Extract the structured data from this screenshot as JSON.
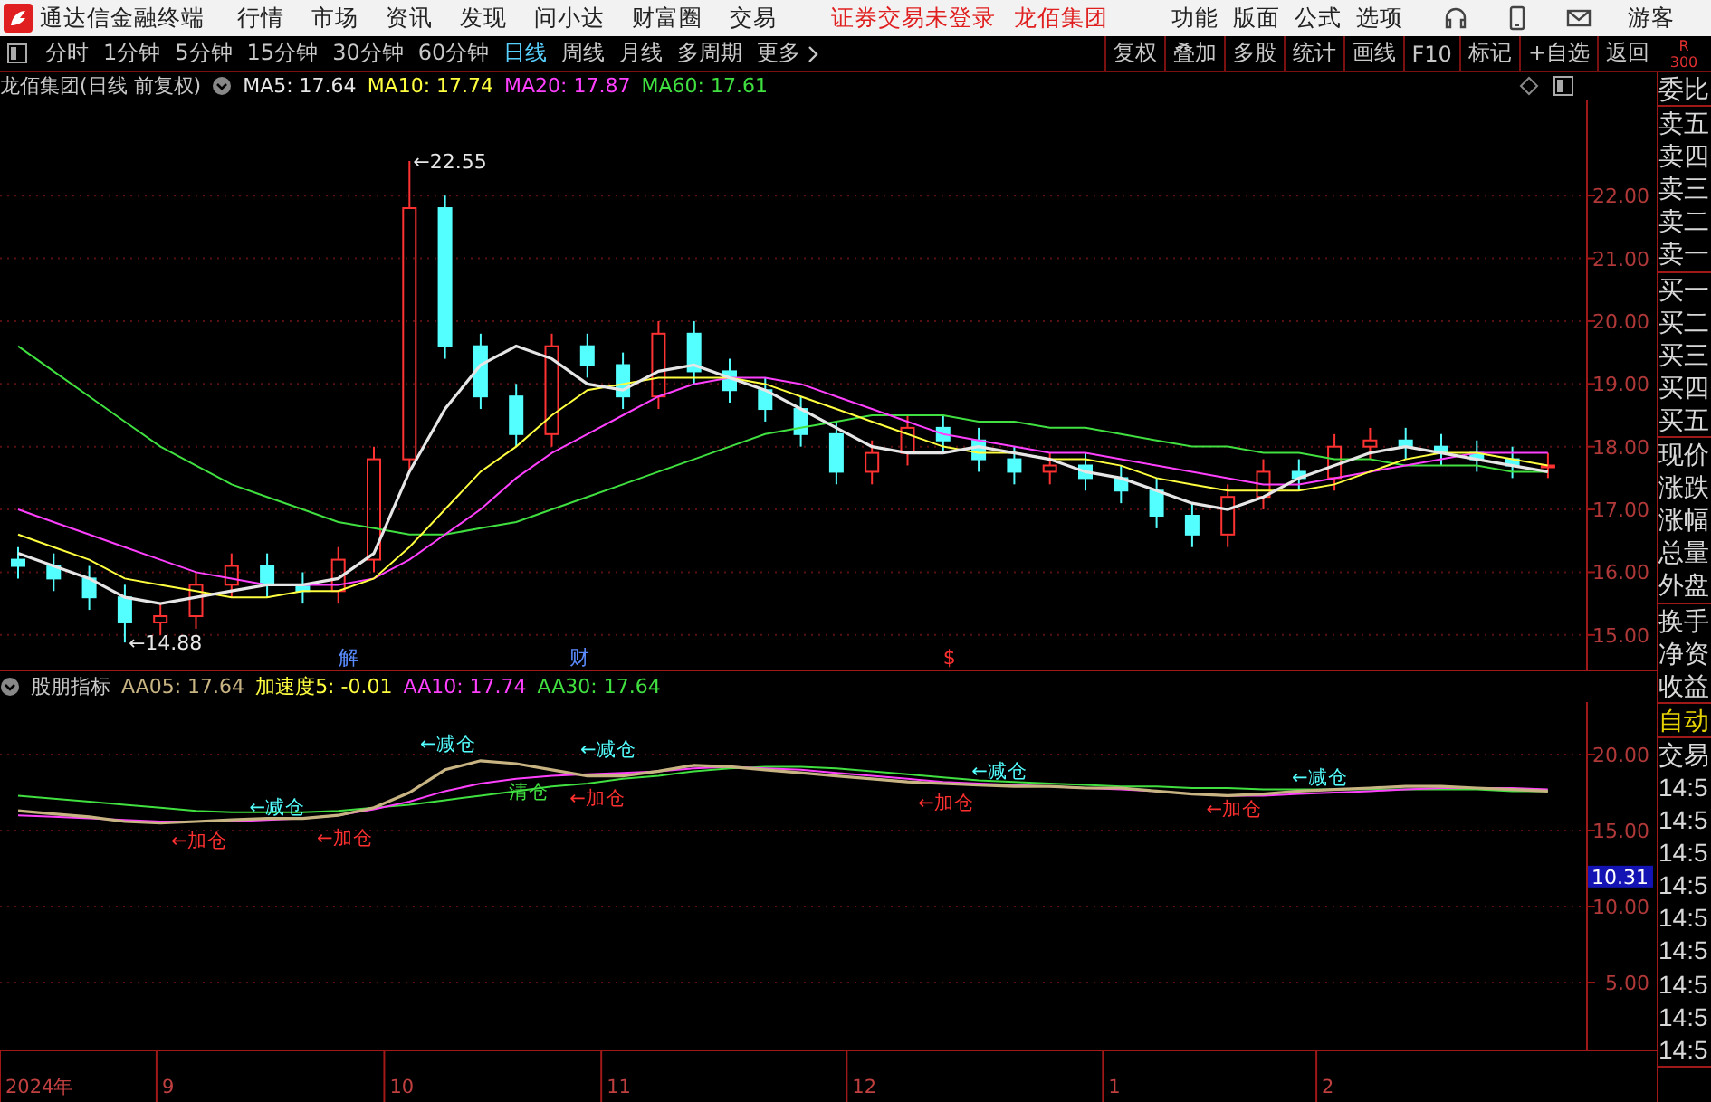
{
  "header": {
    "app_title": "通达信金融终端",
    "menu": [
      "行情",
      "市场",
      "资讯",
      "发现",
      "问小达",
      "财富圈",
      "交易"
    ],
    "notices": [
      "证券交易未登录",
      "龙佰集团"
    ],
    "right_menu": [
      "功能",
      "版面",
      "公式",
      "选项"
    ],
    "user": "游客"
  },
  "toolbar": {
    "periods": [
      {
        "label": "分时",
        "selected": false
      },
      {
        "label": "1分钟",
        "selected": false
      },
      {
        "label": "5分钟",
        "selected": false
      },
      {
        "label": "15分钟",
        "selected": false
      },
      {
        "label": "30分钟",
        "selected": false
      },
      {
        "label": "60分钟",
        "selected": false
      },
      {
        "label": "日线",
        "selected": true
      },
      {
        "label": "周线",
        "selected": false
      },
      {
        "label": "月线",
        "selected": false
      },
      {
        "label": "多周期",
        "selected": false
      },
      {
        "label": "更多",
        "selected": false
      }
    ],
    "buttons": [
      "复权",
      "叠加",
      "多股",
      "统计",
      "画线",
      "F10",
      "标记",
      "+自选",
      "返回"
    ],
    "corner": [
      "R",
      "300"
    ]
  },
  "main_panel": {
    "title": "龙佰集团(日线 前复权)",
    "legend_values": [
      ": 17.64",
      ": 17.74",
      ": 17.87",
      ": 17.61"
    ],
    "events": [
      {
        "text": "解",
        "color": "#5a8cff"
      },
      {
        "text": "财",
        "color": "#5a8cff"
      },
      {
        "text": "$",
        "color": "#ff3030"
      }
    ],
    "chart_data": {
      "type": "candlestick",
      "grid": true,
      "ylim": [
        14.45,
        23.53
      ],
      "yticks": [
        {
          "value": 15,
          "label": "15.00"
        },
        {
          "value": 16,
          "label": "16.00"
        },
        {
          "value": 17,
          "label": "17.00"
        },
        {
          "value": 18,
          "label": "18.00"
        },
        {
          "value": 19,
          "label": "19.00"
        },
        {
          "value": 20,
          "label": "20.00"
        },
        {
          "value": 21,
          "label": "21.00"
        },
        {
          "value": 22,
          "label": "22.00"
        }
      ],
      "ohlc": [
        [
          16.2,
          16.4,
          15.9,
          16.1
        ],
        [
          16.1,
          16.3,
          15.7,
          15.9
        ],
        [
          15.9,
          16.1,
          15.4,
          15.6
        ],
        [
          15.6,
          15.8,
          14.88,
          15.2
        ],
        [
          15.2,
          15.5,
          15.0,
          15.3
        ],
        [
          15.3,
          16.0,
          15.1,
          15.8
        ],
        [
          15.8,
          16.3,
          15.6,
          16.1
        ],
        [
          16.1,
          16.3,
          15.6,
          15.8
        ],
        [
          15.8,
          16.0,
          15.5,
          15.7
        ],
        [
          15.7,
          16.4,
          15.5,
          16.2
        ],
        [
          16.2,
          18.0,
          16.0,
          17.8
        ],
        [
          17.8,
          22.55,
          17.6,
          21.8
        ],
        [
          21.8,
          22.0,
          19.4,
          19.6
        ],
        [
          19.6,
          19.8,
          18.6,
          18.8
        ],
        [
          18.8,
          19.0,
          18.0,
          18.2
        ],
        [
          18.2,
          19.8,
          18.0,
          19.6
        ],
        [
          19.6,
          19.8,
          19.1,
          19.3
        ],
        [
          19.3,
          19.5,
          18.6,
          18.8
        ],
        [
          18.8,
          20.0,
          18.6,
          19.8
        ],
        [
          19.8,
          20.0,
          19.0,
          19.2
        ],
        [
          19.2,
          19.4,
          18.7,
          18.9
        ],
        [
          18.9,
          19.1,
          18.4,
          18.6
        ],
        [
          18.6,
          18.8,
          18.0,
          18.2
        ],
        [
          18.2,
          18.4,
          17.4,
          17.6
        ],
        [
          17.6,
          18.1,
          17.4,
          17.9
        ],
        [
          17.9,
          18.5,
          17.7,
          18.3
        ],
        [
          18.3,
          18.5,
          17.9,
          18.1
        ],
        [
          18.1,
          18.3,
          17.6,
          17.8
        ],
        [
          17.8,
          18.0,
          17.4,
          17.6
        ],
        [
          17.6,
          17.9,
          17.4,
          17.7
        ],
        [
          17.7,
          17.9,
          17.3,
          17.5
        ],
        [
          17.5,
          17.7,
          17.1,
          17.3
        ],
        [
          17.3,
          17.5,
          16.7,
          16.9
        ],
        [
          16.9,
          17.1,
          16.4,
          16.6
        ],
        [
          16.6,
          17.4,
          16.4,
          17.2
        ],
        [
          17.2,
          17.8,
          17.0,
          17.6
        ],
        [
          17.6,
          17.8,
          17.3,
          17.5
        ],
        [
          17.5,
          18.2,
          17.3,
          18.0
        ],
        [
          18.0,
          18.3,
          17.8,
          18.1
        ],
        [
          18.1,
          18.3,
          17.8,
          18.0
        ],
        [
          18.0,
          18.2,
          17.7,
          17.9
        ],
        [
          17.9,
          18.1,
          17.6,
          17.8
        ],
        [
          17.8,
          18.0,
          17.5,
          17.7
        ],
        [
          17.7,
          17.9,
          17.5,
          17.7
        ]
      ],
      "series": [
        {
          "name": "MA5",
          "type": "line",
          "color": "#e6e6e6",
          "values": [
            16.3,
            16.1,
            15.9,
            15.6,
            15.5,
            15.6,
            15.7,
            15.8,
            15.8,
            15.9,
            16.3,
            17.6,
            18.6,
            19.3,
            19.6,
            19.4,
            19.0,
            18.9,
            19.2,
            19.3,
            19.1,
            18.9,
            18.6,
            18.3,
            18.0,
            17.9,
            17.9,
            18.0,
            17.9,
            17.8,
            17.6,
            17.5,
            17.3,
            17.1,
            17.0,
            17.2,
            17.5,
            17.7,
            17.9,
            18.0,
            17.9,
            17.8,
            17.7,
            17.6
          ]
        },
        {
          "name": "MA10",
          "type": "line",
          "color": "#ffff40",
          "values": [
            16.6,
            16.4,
            16.2,
            15.9,
            15.8,
            15.7,
            15.6,
            15.6,
            15.7,
            15.7,
            15.9,
            16.4,
            17.0,
            17.6,
            18.0,
            18.5,
            18.9,
            19.0,
            19.1,
            19.1,
            19.1,
            19.0,
            18.8,
            18.6,
            18.4,
            18.2,
            18.0,
            17.9,
            17.9,
            17.8,
            17.8,
            17.7,
            17.5,
            17.4,
            17.3,
            17.3,
            17.3,
            17.4,
            17.6,
            17.8,
            17.9,
            17.9,
            17.8,
            17.7
          ]
        },
        {
          "name": "MA20",
          "type": "line",
          "color": "#ff40ff",
          "values": [
            17.0,
            16.8,
            16.6,
            16.4,
            16.2,
            16.0,
            15.9,
            15.8,
            15.8,
            15.8,
            15.9,
            16.2,
            16.6,
            17.0,
            17.5,
            17.9,
            18.2,
            18.5,
            18.8,
            19.0,
            19.1,
            19.1,
            19.0,
            18.8,
            18.6,
            18.4,
            18.2,
            18.1,
            18.0,
            17.9,
            17.9,
            17.8,
            17.7,
            17.6,
            17.5,
            17.4,
            17.4,
            17.5,
            17.6,
            17.7,
            17.8,
            17.9,
            17.9,
            17.9
          ]
        },
        {
          "name": "MA60",
          "type": "line",
          "color": "#40e040",
          "values": [
            19.6,
            19.2,
            18.8,
            18.4,
            18.0,
            17.7,
            17.4,
            17.2,
            17.0,
            16.8,
            16.7,
            16.6,
            16.6,
            16.7,
            16.8,
            17.0,
            17.2,
            17.4,
            17.6,
            17.8,
            18.0,
            18.2,
            18.3,
            18.4,
            18.5,
            18.5,
            18.5,
            18.4,
            18.4,
            18.3,
            18.3,
            18.2,
            18.1,
            18.0,
            18.0,
            17.9,
            17.9,
            17.8,
            17.8,
            17.7,
            17.7,
            17.7,
            17.6,
            17.6
          ]
        }
      ],
      "annotations": [
        "←22.55",
        "←14.88"
      ]
    }
  },
  "indicator_panel": {
    "title": "股朋指标",
    "legend_values": [
      ": 17.64",
      ": 17.74",
      ": 17.64"
    ],
    "extra_legend": {
      "text": "加速度5: -0.01",
      "color": "#ffff40"
    },
    "cursor_value": "10.31",
    "time_axis": [
      "2024年",
      "9",
      "10",
      "11",
      "12",
      "1",
      "2"
    ],
    "signals": [
      {
        "text": "←加仓",
        "color": "#ff3030"
      },
      {
        "text": "←减仓",
        "color": "#54ffff"
      },
      {
        "text": "←加仓",
        "color": "#ff3030"
      },
      {
        "text": "←减仓",
        "color": "#54ffff"
      },
      {
        "text": "清仓",
        "color": "#40e040"
      },
      {
        "text": "←加仓",
        "color": "#ff3030"
      },
      {
        "text": "←减仓",
        "color": "#54ffff"
      },
      {
        "text": "←加仓",
        "color": "#ff3030"
      },
      {
        "text": "←减仓",
        "color": "#54ffff"
      },
      {
        "text": "←加仓",
        "color": "#ff3030"
      },
      {
        "text": "←减仓",
        "color": "#54ffff"
      }
    ],
    "chart_data": {
      "type": "line",
      "grid": true,
      "ylim": [
        0.6,
        23.45
      ],
      "yticks": [
        {
          "value": 5,
          "label": "5.00"
        },
        {
          "value": 10,
          "label": "10.00"
        },
        {
          "value": 15,
          "label": "15.00"
        },
        {
          "value": 20,
          "label": "20.00"
        }
      ],
      "series": [
        {
          "name": "AA05",
          "color": "#c8b482",
          "values": [
            16.3,
            16.1,
            15.9,
            15.6,
            15.5,
            15.6,
            15.7,
            15.8,
            15.8,
            16.0,
            16.5,
            17.5,
            19.0,
            19.6,
            19.4,
            19.0,
            18.6,
            18.6,
            18.9,
            19.3,
            19.2,
            19.0,
            18.8,
            18.6,
            18.4,
            18.2,
            18.1,
            18.0,
            17.9,
            17.9,
            17.8,
            17.8,
            17.6,
            17.4,
            17.3,
            17.4,
            17.6,
            17.7,
            17.8,
            17.9,
            17.9,
            17.8,
            17.7,
            17.6
          ]
        },
        {
          "name": "AA10",
          "color": "#ff40ff",
          "values": [
            16.0,
            15.9,
            15.8,
            15.7,
            15.6,
            15.6,
            15.6,
            15.7,
            15.8,
            16.0,
            16.4,
            16.9,
            17.6,
            18.1,
            18.4,
            18.6,
            18.7,
            18.8,
            18.9,
            19.1,
            19.2,
            19.1,
            19.0,
            18.8,
            18.6,
            18.4,
            18.2,
            18.1,
            18.0,
            17.9,
            17.8,
            17.7,
            17.6,
            17.4,
            17.3,
            17.3,
            17.4,
            17.5,
            17.6,
            17.7,
            17.8,
            17.8,
            17.8,
            17.7
          ]
        },
        {
          "name": "AA30",
          "color": "#40e040",
          "values": [
            17.3,
            17.1,
            16.9,
            16.7,
            16.5,
            16.3,
            16.2,
            16.2,
            16.2,
            16.3,
            16.5,
            16.7,
            17.0,
            17.3,
            17.6,
            17.9,
            18.1,
            18.4,
            18.6,
            18.9,
            19.1,
            19.2,
            19.2,
            19.1,
            18.9,
            18.7,
            18.5,
            18.3,
            18.2,
            18.1,
            18.0,
            17.9,
            17.9,
            17.8,
            17.8,
            17.7,
            17.7,
            17.7,
            17.7,
            17.7,
            17.7,
            17.7,
            17.6,
            17.6
          ]
        }
      ]
    }
  },
  "side_panel": [
    {
      "items": [
        "委比"
      ],
      "highlight": false
    },
    {
      "items": [
        "卖五",
        "卖四",
        "卖三",
        "卖二",
        "卖一"
      ],
      "highlight": false
    },
    {
      "items": [
        "买一",
        "买二",
        "买三",
        "买四",
        "买五"
      ],
      "highlight": false
    },
    {
      "items": [
        "现价",
        "涨跌",
        "涨幅",
        "总量",
        "外盘"
      ],
      "highlight": false
    },
    {
      "items": [
        "换手",
        "净资",
        "收益"
      ],
      "highlight": false
    },
    {
      "items": [
        "自动"
      ],
      "highlight": true
    },
    {
      "items": [
        "交易",
        "14:5",
        "14:5",
        "14:5",
        "14:5",
        "14:5",
        "14:5",
        "14:5",
        "14:5",
        "14:5"
      ],
      "highlight": false
    }
  ]
}
